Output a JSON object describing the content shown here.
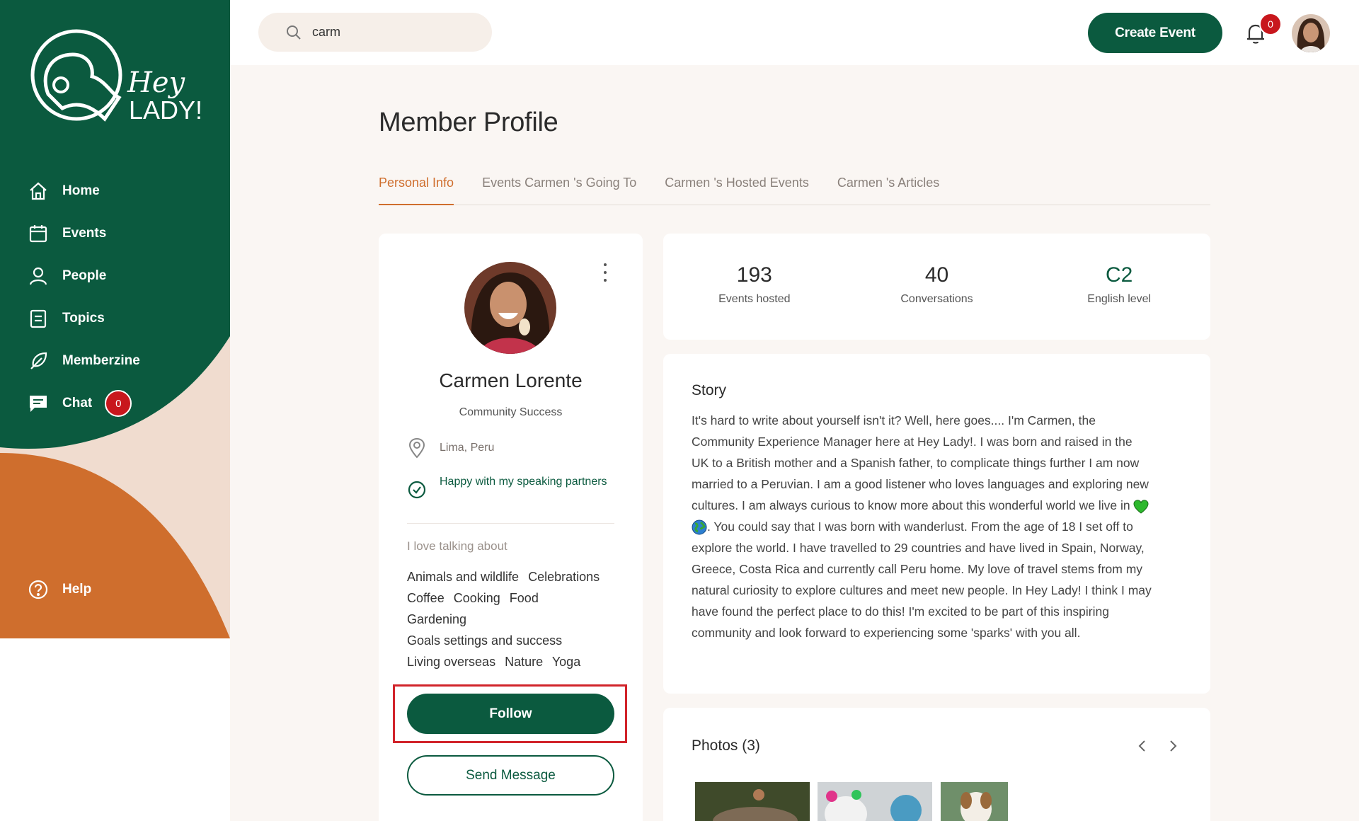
{
  "sidebar": {
    "logo_text_top": "Hey",
    "logo_text_bottom": "LADY!",
    "items": [
      {
        "label": "Home",
        "icon": "home-icon"
      },
      {
        "label": "Events",
        "icon": "calendar-icon"
      },
      {
        "label": "People",
        "icon": "person-icon"
      },
      {
        "label": "Topics",
        "icon": "document-icon"
      },
      {
        "label": "Memberzine",
        "icon": "feather-icon"
      },
      {
        "label": "Chat",
        "icon": "chat-icon",
        "badge": "0"
      }
    ],
    "help_label": "Help"
  },
  "header": {
    "search_value": "carm",
    "create_event_label": "Create Event",
    "notification_count": "0"
  },
  "page_title": "Member Profile",
  "tabs": [
    {
      "label": "Personal Info",
      "active": true
    },
    {
      "label": "Events Carmen 's Going To",
      "active": false
    },
    {
      "label": "Carmen 's Hosted Events",
      "active": false
    },
    {
      "label": "Carmen 's Articles",
      "active": false
    }
  ],
  "profile": {
    "name": "Carmen Lorente",
    "role": "Community Success",
    "location": "Lima, Peru",
    "status": "Happy with my speaking partners",
    "love_title": "I love talking about",
    "topics": [
      "Animals and wildlife",
      "Celebrations",
      "Coffee",
      "Cooking",
      "Food",
      "Gardening",
      "Goals settings and success",
      "Living overseas",
      "Nature",
      "Yoga"
    ],
    "follow_label": "Follow",
    "message_label": "Send Message"
  },
  "stats": [
    {
      "value": "193",
      "label": "Events hosted"
    },
    {
      "value": "40",
      "label": "Conversations"
    },
    {
      "value": "C2",
      "label": "English level"
    }
  ],
  "story": {
    "title": "Story",
    "text_part1": "It's hard to write about yourself isn't it? Well, here goes.... I'm Carmen, the Community Experience Manager here at Hey Lady!. I was born and raised in the UK to a British mother and a Spanish father, to complicate things further I am now married to a Peruvian. I am a good listener who loves languages and exploring new cultures. I am always curious to know more about this wonderful world we live in",
    "text_part2": ". You could say that I was born with wanderlust. From the age of 18 I set off to explore the world. I have travelled to 29 countries and have lived in Spain, Norway, Greece, Costa Rica and currently call Peru home. My love of travel stems from my natural curiosity to explore cultures and meet new people. In Hey Lady! I think I may have found the perfect place to do this! I'm excited to be part of this inspiring community and look forward to experiencing some 'sparks' with you all."
  },
  "photos": {
    "title": "Photos (3)"
  },
  "colors": {
    "brand_green": "#0b5a3f",
    "accent_orange": "#cf6e2d",
    "badge_red": "#c8171d"
  }
}
